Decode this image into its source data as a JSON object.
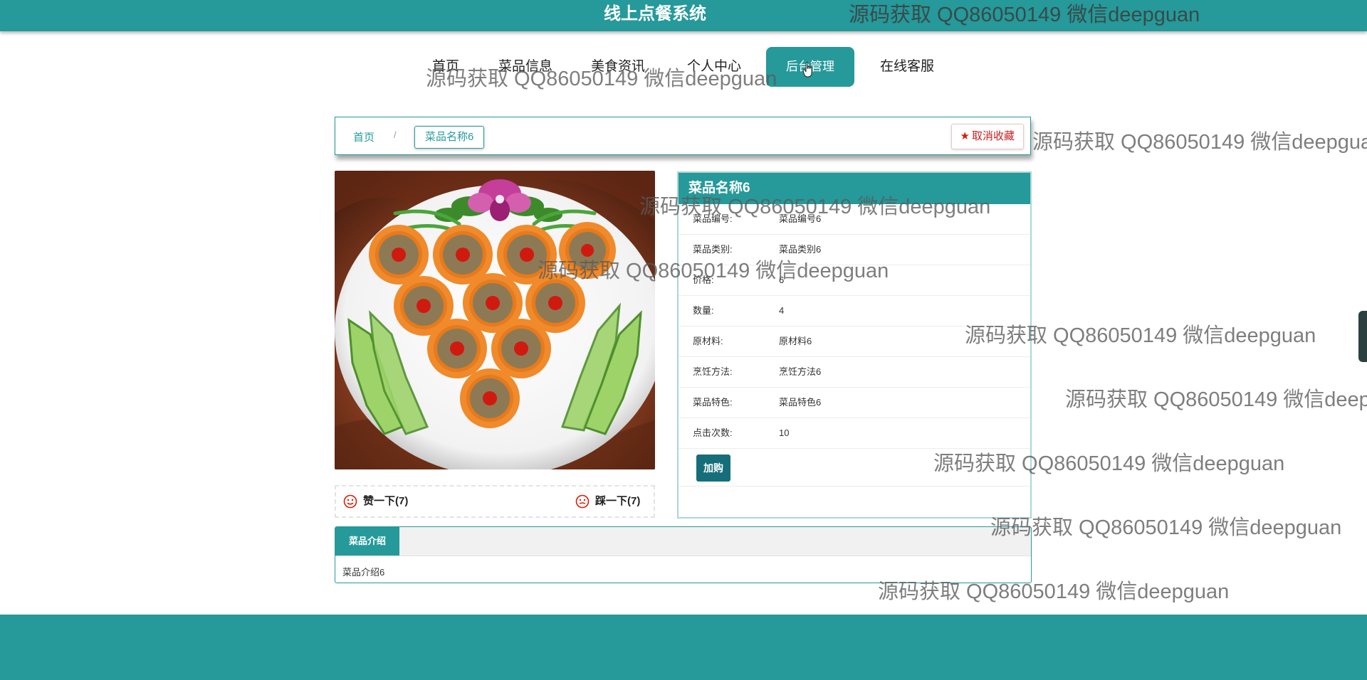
{
  "header": {
    "title": "线上点餐系统"
  },
  "nav": {
    "items": [
      {
        "label": "首页"
      },
      {
        "label": "菜品信息"
      },
      {
        "label": "美食资讯"
      },
      {
        "label": "个人中心"
      },
      {
        "label": "后台管理"
      },
      {
        "label": "在线客服"
      }
    ],
    "active_index": 4
  },
  "breadcrumb": {
    "home": "首页",
    "separator": "/",
    "current": "菜品名称6"
  },
  "favorite_button": {
    "label": "取消收藏"
  },
  "dish": {
    "name": "菜品名称6",
    "fields": [
      {
        "label": "菜品编号:",
        "value": "菜品编号6"
      },
      {
        "label": "菜品类别:",
        "value": "菜品类别6"
      },
      {
        "label": "价格:",
        "value": "6"
      },
      {
        "label": "数量:",
        "value": "4"
      },
      {
        "label": "原材料:",
        "value": "原材料6"
      },
      {
        "label": "烹饪方法:",
        "value": "烹饪方法6"
      },
      {
        "label": "菜品特色:",
        "value": "菜品特色6"
      },
      {
        "label": "点击次数:",
        "value": "10"
      }
    ],
    "buy_label": "加购"
  },
  "votes": {
    "like_label": "赞一下(7)",
    "dislike_label": "踩一下(7)"
  },
  "intro": {
    "tab_label": "菜品介绍",
    "content": "菜品介绍6"
  },
  "watermark": {
    "text": "源码获取 QQ86050149 微信deepguan"
  },
  "colors": {
    "primary": "#26999a",
    "button_dark": "#166e7a",
    "accent_red": "#d81e06"
  }
}
